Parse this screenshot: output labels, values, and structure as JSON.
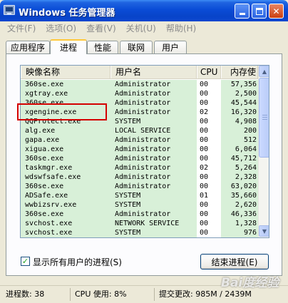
{
  "window": {
    "title": "Windows 任务管理器"
  },
  "menu": [
    "文件(F)",
    "选项(O)",
    "查看(V)",
    "关机(U)",
    "帮助(H)"
  ],
  "tabs": [
    {
      "label": "应用程序",
      "active": false
    },
    {
      "label": "进程",
      "active": true
    },
    {
      "label": "性能",
      "active": false
    },
    {
      "label": "联网",
      "active": false
    },
    {
      "label": "用户",
      "active": false
    }
  ],
  "columns": [
    "映像名称",
    "用户名",
    "CPU",
    "内存使"
  ],
  "processes": [
    [
      "360se.exe",
      "Administrator",
      "00",
      "57,356"
    ],
    [
      "xgtray.exe",
      "Administrator",
      "00",
      "2,500"
    ],
    [
      "360se.exe",
      "Administrator",
      "00",
      "45,544"
    ],
    [
      "xgengine.exe",
      "Administrator",
      "02",
      "16,320"
    ],
    [
      "QQProtect.exe",
      "SYSTEM",
      "00",
      "4,908"
    ],
    [
      "alg.exe",
      "LOCAL SERVICE",
      "00",
      "200"
    ],
    [
      "gapa.exe",
      "Administrator",
      "00",
      "512"
    ],
    [
      "xigua.exe",
      "Administrator",
      "00",
      "6,064"
    ],
    [
      "360se.exe",
      "Administrator",
      "00",
      "45,712"
    ],
    [
      "taskmgr.exe",
      "Administrator",
      "02",
      "5,264"
    ],
    [
      "wdswfsafe.exe",
      "Administrator",
      "00",
      "2,328"
    ],
    [
      "360se.exe",
      "Administrator",
      "00",
      "63,020"
    ],
    [
      "ADSafe.exe",
      "SYSTEM",
      "01",
      "35,660"
    ],
    [
      "wwbizsrv.exe",
      "SYSTEM",
      "00",
      "2,620"
    ],
    [
      "360se.exe",
      "Administrator",
      "00",
      "46,336"
    ],
    [
      "svchost.exe",
      "NETWORK SERVICE",
      "00",
      "1,328"
    ],
    [
      "svchost.exe",
      "SYSTEM",
      "00",
      "976"
    ]
  ],
  "show_all_users": {
    "label": "显示所有用户的进程(S)",
    "checked": true
  },
  "end_process_label": "结束进程(E)",
  "status": {
    "processes": "进程数: 38",
    "cpu": "CPU 使用: 8%",
    "commit": "提交更改: 985M / 2439M"
  },
  "watermark": "Bai度经验"
}
